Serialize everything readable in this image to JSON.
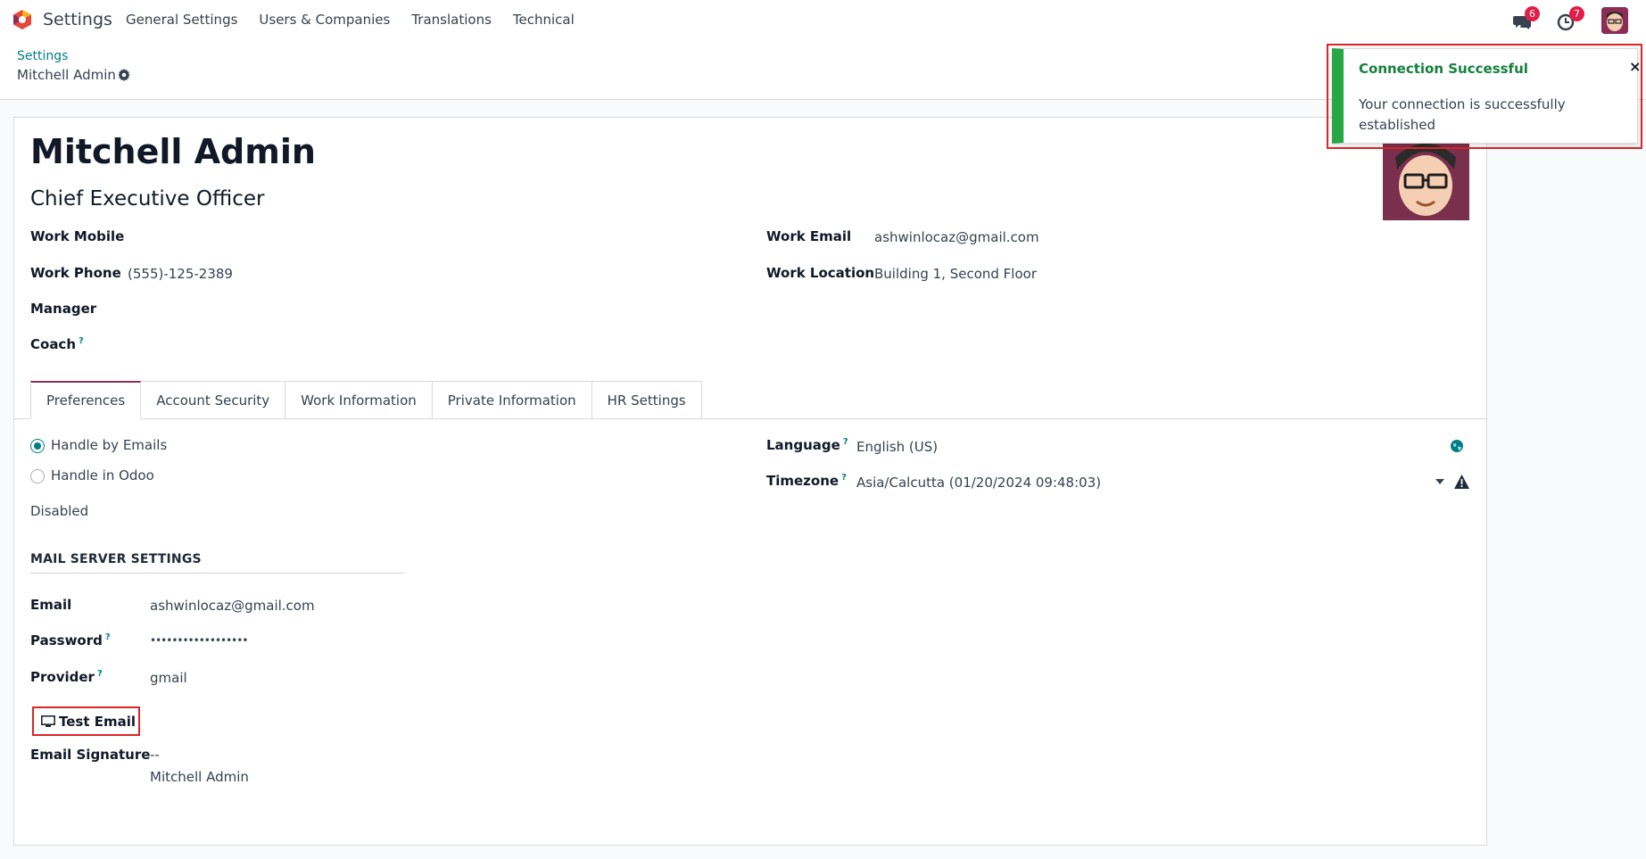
{
  "topbar": {
    "app_name": "Settings",
    "menu": [
      "General Settings",
      "Users & Companies",
      "Translations",
      "Technical"
    ],
    "messages_count": "6",
    "activities_count": "7"
  },
  "breadcrumb": {
    "parent": "Settings",
    "current": "Mitchell Admin"
  },
  "employee": {
    "name": "Mitchell Admin",
    "job_title": "Chief Executive Officer",
    "fields": {
      "work_mobile_label": "Work Mobile",
      "work_phone_label": "Work Phone",
      "work_phone_value": "(555)-125-2389",
      "manager_label": "Manager",
      "coach_label": "Coach",
      "work_email_label": "Work Email",
      "work_email_value": "ashwinlocaz@gmail.com",
      "work_location_label": "Work Location",
      "work_location_value": "Building 1, Second Floor"
    }
  },
  "tabs": [
    "Preferences",
    "Account Security",
    "Work Information",
    "Private Information",
    "HR Settings"
  ],
  "preferences": {
    "notification_options": [
      "Handle by Emails",
      "Handle in Odoo"
    ],
    "selected_option": "Handle by Emails",
    "status_text": "Disabled",
    "language_label": "Language",
    "language_value": "English (US)",
    "timezone_label": "Timezone",
    "timezone_value": "Asia/Calcutta (01/20/2024 09:48:03)"
  },
  "mail_server": {
    "section_title": "MAIL SERVER SETTINGS",
    "email_label": "Email",
    "email_value": "ashwinlocaz@gmail.com",
    "password_label": "Password",
    "password_value": "••••••••••••••••••",
    "provider_label": "Provider",
    "provider_value": "gmail",
    "test_button": "Test Email",
    "signature_label": "Email Signature",
    "signature_line1": "--",
    "signature_line2": "Mitchell Admin"
  },
  "toast": {
    "title": "Connection Successful",
    "message": "Your connection is successfully established",
    "close": "×"
  },
  "help_mark": "?",
  "colors": {
    "accent": "#017e84",
    "brand": "#8b2d55",
    "success": "#28a745",
    "highlight": "#dc2626",
    "badge": "#e11d48"
  }
}
